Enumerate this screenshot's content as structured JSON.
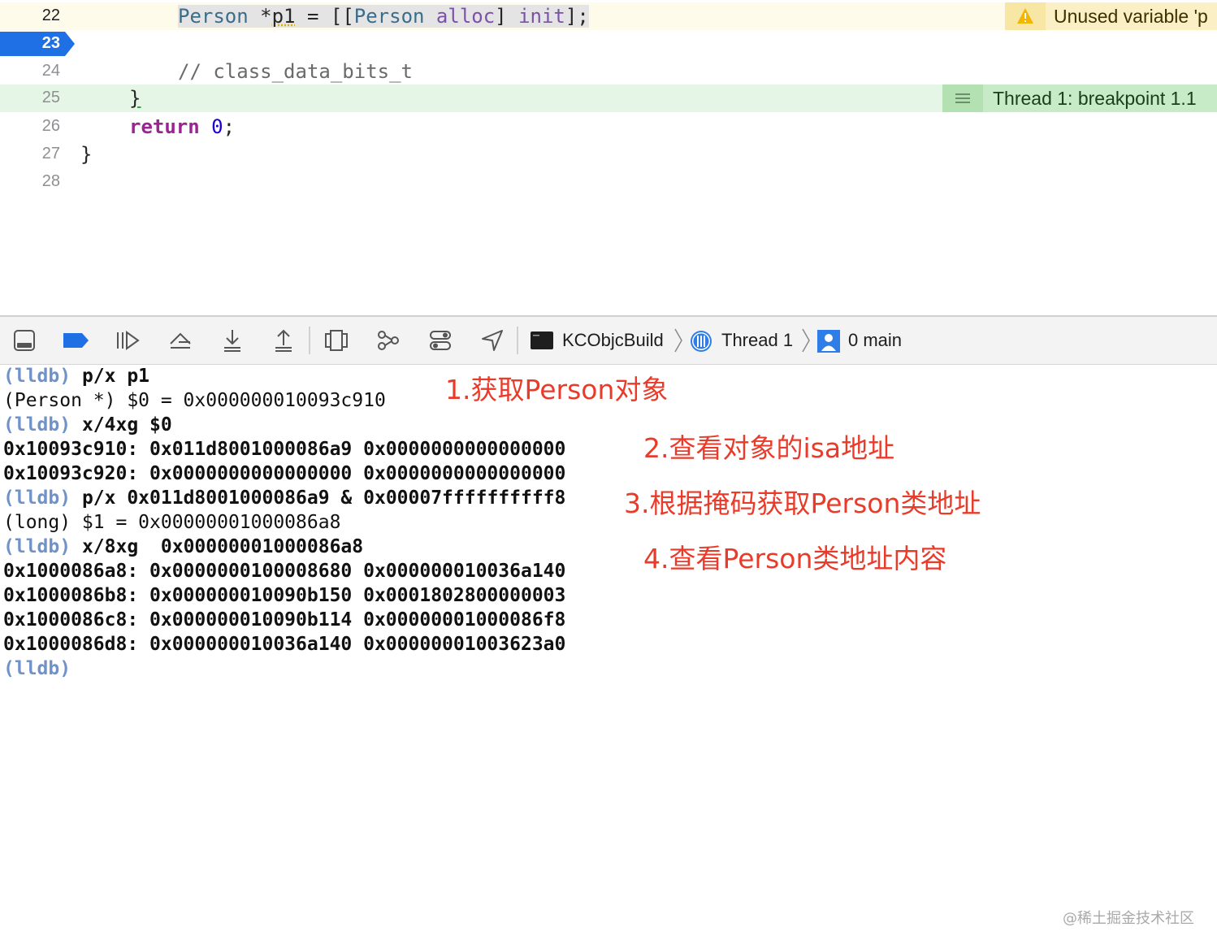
{
  "editor": {
    "lines": [
      {
        "num": "22",
        "tokens": {
          "type1": "Person",
          "rest1": " *",
          "var": "p1",
          "rest2": " = [[",
          "type2": "Person",
          "sp": " ",
          "meth1": "alloc",
          "close1": "] ",
          "meth2": "init",
          "close2": "];"
        }
      },
      {
        "num": "23"
      },
      {
        "num": "24",
        "text": "// class_data_bits_t"
      },
      {
        "num": "25",
        "text": "}"
      },
      {
        "num": "26",
        "kw": "return",
        "num_tok": "0",
        "semi": ";"
      },
      {
        "num": "27",
        "text": "}"
      },
      {
        "num": "28"
      }
    ],
    "warning_annotation": "Unused variable 'p",
    "thread_annotation": "Thread 1: breakpoint 1.1"
  },
  "debug_bar": {
    "icons": [
      "hide-debug-area-icon",
      "breakpoints-toggle-icon",
      "continue-icon",
      "step-over-icon",
      "step-into-icon",
      "step-out-icon",
      "view-hierarchy-icon",
      "memory-graph-icon",
      "environment-overrides-icon",
      "simulate-location-icon"
    ],
    "breadcrumbs": {
      "target": "KCObjcBuild",
      "thread": "Thread 1",
      "frame": "0 main"
    }
  },
  "console": {
    "lines": [
      {
        "prompt": "(lldb)",
        "cmd": " p/x p1"
      },
      {
        "out": "(Person *) $0 = 0x000000010093c910"
      },
      {
        "prompt": "(lldb)",
        "cmd": " x/4xg $0"
      },
      {
        "out": "0x10093c910: 0x011d8001000086a9 0x0000000000000000"
      },
      {
        "out": "0x10093c920: 0x0000000000000000 0x0000000000000000"
      },
      {
        "prompt": "(lldb)",
        "cmd": " p/x 0x011d8001000086a9 & 0x00007ffffffffff8"
      },
      {
        "out": "(long) $1 = 0x00000001000086a8"
      },
      {
        "prompt": "(lldb)",
        "cmd": " x/8xg  0x00000001000086a8"
      },
      {
        "out": "0x1000086a8: 0x0000000100008680 0x000000010036a140"
      },
      {
        "out": "0x1000086b8: 0x000000010090b150 0x0001802800000003"
      },
      {
        "out": "0x1000086c8: 0x000000010090b114 0x00000001000086f8"
      },
      {
        "out": "0x1000086d8: 0x000000010036a140 0x00000001003623a0"
      },
      {
        "prompt": "(lldb)",
        "cmd": ""
      }
    ],
    "notes": [
      "1.获取Person对象",
      "2.查看对象的isa地址",
      "3.根据掩码获取Person类地址",
      "4.查看Person类地址内容"
    ]
  },
  "watermark": "@稀土掘金技术社区",
  "colors": {
    "prompt": "#6f92c9",
    "note": "#ea3b2a",
    "breakpoint": "#1f6fe5",
    "current_line": "#e6f6e6",
    "warning": "#fbf0c5"
  }
}
